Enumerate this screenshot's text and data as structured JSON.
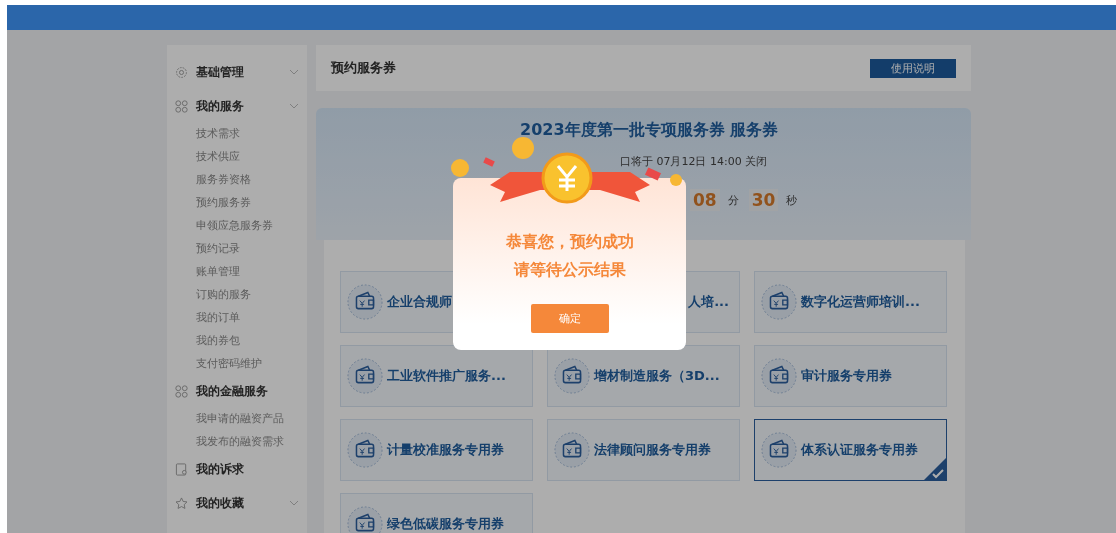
{
  "sidebar": {
    "groups": [
      {
        "label": "基础管理",
        "kind": "gear",
        "chevron": true
      },
      {
        "label": "我的服务",
        "kind": "grid",
        "chevron": true,
        "children": [
          {
            "label": "技术需求"
          },
          {
            "label": "技术供应"
          },
          {
            "label": "服务券资格"
          },
          {
            "label": "预约服务券"
          },
          {
            "label": "申领应急服务券"
          },
          {
            "label": "预约记录"
          },
          {
            "label": "账单管理"
          },
          {
            "label": "订购的服务"
          },
          {
            "label": "我的订单"
          },
          {
            "label": "我的券包"
          },
          {
            "label": "支付密码维护"
          }
        ]
      },
      {
        "label": "我的金融服务",
        "kind": "grid",
        "chevron": false,
        "children": [
          {
            "label": "我申请的融资产品"
          },
          {
            "label": "我发布的融资需求"
          }
        ]
      },
      {
        "label": "我的诉求",
        "kind": "doc",
        "chevron": false
      },
      {
        "label": "我的收藏",
        "kind": "star",
        "chevron": true
      }
    ]
  },
  "header": {
    "title": "预约服务券",
    "button": "使用说明"
  },
  "banner": {
    "title": "2023年度第一批专项服务券 服务券",
    "notice": "口将于 07月12日 14:00 关闭",
    "countdown": [
      {
        "value": "08",
        "unit": "分"
      },
      {
        "value": "30",
        "unit": "秒"
      }
    ]
  },
  "vouchers": [
    {
      "label": "企业合规师",
      "covered": false,
      "selected": false
    },
    {
      "label": "人培...",
      "covered": true,
      "selected": false
    },
    {
      "label": "数字化运营师培训...",
      "covered": false,
      "selected": false
    },
    {
      "label": "工业软件推广服务...",
      "covered": false,
      "selected": false
    },
    {
      "label": "增材制造服务（3D...",
      "covered": false,
      "selected": false
    },
    {
      "label": "审计服务专用券",
      "covered": false,
      "selected": false
    },
    {
      "label": "计量校准服务专用券",
      "covered": false,
      "selected": false
    },
    {
      "label": "法律顾问服务专用券",
      "covered": false,
      "selected": false
    },
    {
      "label": "体系认证服务专用券",
      "covered": false,
      "selected": true
    },
    {
      "label": "绿色低碳服务专用券",
      "covered": false,
      "selected": false
    }
  ],
  "dialog": {
    "lines": [
      "恭喜您，预约成功",
      "请等待公示结果"
    ],
    "button": "确定"
  }
}
